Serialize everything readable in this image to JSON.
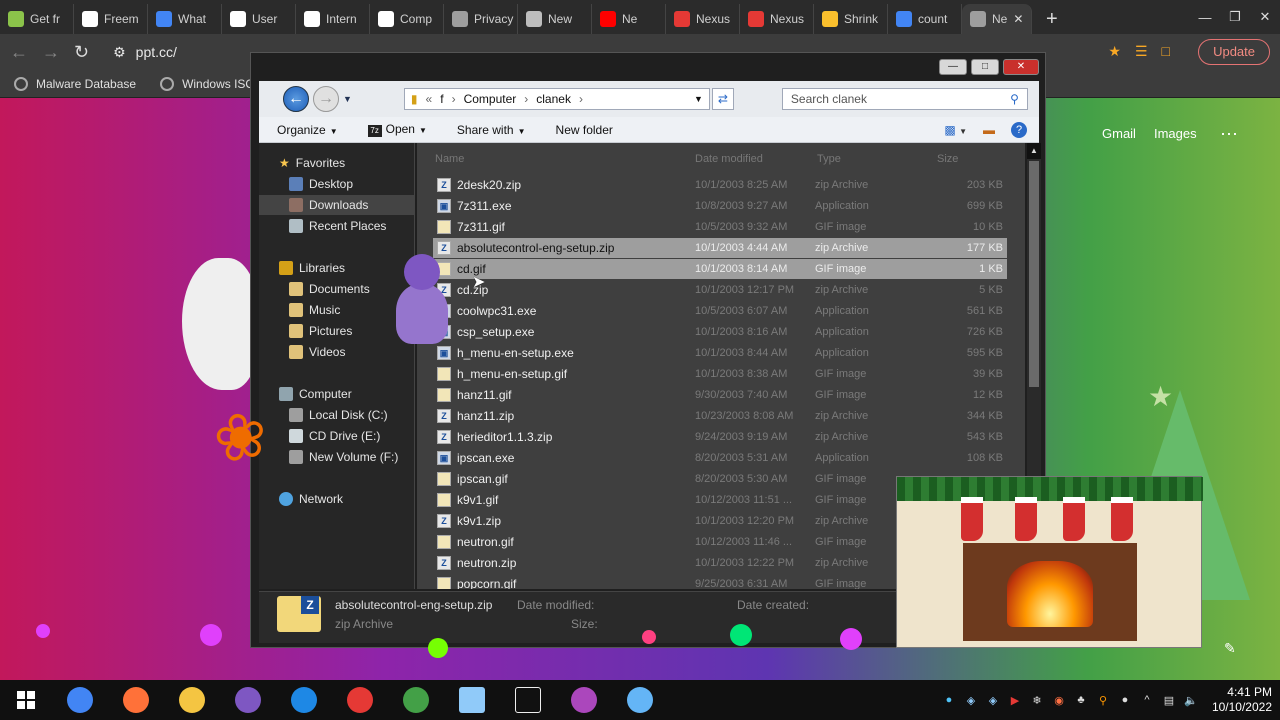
{
  "browser": {
    "tabs": [
      {
        "label": "Get fr",
        "fav_color": "#8bc34a"
      },
      {
        "label": "Freem",
        "fav_color": "#ffffff"
      },
      {
        "label": "What",
        "fav_color": "#4285f4"
      },
      {
        "label": "User",
        "fav_color": "#ffffff"
      },
      {
        "label": "Intern",
        "fav_color": "#ffffff"
      },
      {
        "label": "Comp",
        "fav_color": "#ffffff"
      },
      {
        "label": "Privacy en",
        "fav_color": "#9e9e9e"
      },
      {
        "label": "New",
        "fav_color": "#bdbdbd"
      },
      {
        "label": "Ne",
        "fav_color": "#ff0000"
      },
      {
        "label": "Nexus",
        "fav_color": "#e53935"
      },
      {
        "label": "Nexus",
        "fav_color": "#e53935"
      },
      {
        "label": "Shrink",
        "fav_color": "#fbc02d"
      },
      {
        "label": "count",
        "fav_color": "#4285f4"
      },
      {
        "label": "Ne",
        "fav_color": "#9e9e9e"
      }
    ],
    "new_tab": "+",
    "url": "ppt.cc/",
    "update_label": "Update",
    "bookmarks": [
      "Malware Database",
      "Windows ISOS"
    ]
  },
  "google": {
    "gmail": "Gmail",
    "images": "Images",
    "apps_icon": "apps-grid-icon"
  },
  "explorer": {
    "breadcrumb": {
      "lead": "«",
      "parts": [
        "f",
        "Computer",
        "clanek"
      ]
    },
    "search_placeholder": "Search clanek",
    "commands": {
      "organize": "Organize",
      "open": "Open",
      "share": "Share with",
      "new_folder": "New folder"
    },
    "nav": {
      "favorites": "Favorites",
      "desktop": "Desktop",
      "downloads": "Downloads",
      "recent": "Recent Places",
      "libraries": "Libraries",
      "documents": "Documents",
      "music": "Music",
      "pictures": "Pictures",
      "videos": "Videos",
      "computer": "Computer",
      "local_disk": "Local Disk (C:)",
      "cd_drive": "CD Drive (E:)",
      "new_volume": "New Volume (F:)",
      "network": "Network"
    },
    "columns": {
      "name": "Name",
      "date": "Date modified",
      "type": "Type",
      "size": "Size"
    },
    "files": [
      {
        "name": "2desk20.zip",
        "date": "10/1/2003 8:25 AM",
        "type": "zip Archive",
        "size": "203 KB",
        "kind": "zip"
      },
      {
        "name": "7z311.exe",
        "date": "10/8/2003 9:27 AM",
        "type": "Application",
        "size": "699 KB",
        "kind": "exe"
      },
      {
        "name": "7z311.gif",
        "date": "10/5/2003 9:32 AM",
        "type": "GIF image",
        "size": "10 KB",
        "kind": "gif"
      },
      {
        "name": "absolutecontrol-eng-setup.zip",
        "date": "10/1/2003 4:44 AM",
        "type": "zip Archive",
        "size": "177 KB",
        "kind": "zip",
        "selected": true
      },
      {
        "name": "cd.gif",
        "date": "10/1/2003 8:14 AM",
        "type": "GIF image",
        "size": "1 KB",
        "kind": "gif",
        "selected": true
      },
      {
        "name": "cd.zip",
        "date": "10/1/2003 12:17 PM",
        "type": "zip Archive",
        "size": "5 KB",
        "kind": "zip"
      },
      {
        "name": "coolwpc31.exe",
        "date": "10/5/2003 6:07 AM",
        "type": "Application",
        "size": "561 KB",
        "kind": "exe"
      },
      {
        "name": "csp_setup.exe",
        "date": "10/1/2003 8:16 AM",
        "type": "Application",
        "size": "726 KB",
        "kind": "exe"
      },
      {
        "name": "h_menu-en-setup.exe",
        "date": "10/1/2003 8:44 AM",
        "type": "Application",
        "size": "595 KB",
        "kind": "exe"
      },
      {
        "name": "h_menu-en-setup.gif",
        "date": "10/1/2003 8:38 AM",
        "type": "GIF image",
        "size": "39 KB",
        "kind": "gif"
      },
      {
        "name": "hanz11.gif",
        "date": "9/30/2003 7:40 AM",
        "type": "GIF image",
        "size": "12 KB",
        "kind": "gif"
      },
      {
        "name": "hanz11.zip",
        "date": "10/23/2003 8:08 AM",
        "type": "zip Archive",
        "size": "344 KB",
        "kind": "zip"
      },
      {
        "name": "herieditor1.1.3.zip",
        "date": "9/24/2003 9:19 AM",
        "type": "zip Archive",
        "size": "543 KB",
        "kind": "zip"
      },
      {
        "name": "ipscan.exe",
        "date": "8/20/2003 5:31 AM",
        "type": "Application",
        "size": "108 KB",
        "kind": "exe"
      },
      {
        "name": "ipscan.gif",
        "date": "8/20/2003 5:30 AM",
        "type": "GIF image",
        "size": "",
        "kind": "gif"
      },
      {
        "name": "k9v1.gif",
        "date": "10/12/2003 11:51 ...",
        "type": "GIF image",
        "size": "",
        "kind": "gif"
      },
      {
        "name": "k9v1.zip",
        "date": "10/1/2003 12:20 PM",
        "type": "zip Archive",
        "size": "",
        "kind": "zip"
      },
      {
        "name": "neutron.gif",
        "date": "10/12/2003 11:46 ...",
        "type": "GIF image",
        "size": "",
        "kind": "gif"
      },
      {
        "name": "neutron.zip",
        "date": "10/1/2003 12:22 PM",
        "type": "zip Archive",
        "size": "",
        "kind": "zip"
      },
      {
        "name": "popcorn.gif",
        "date": "9/25/2003 6:31 AM",
        "type": "GIF image",
        "size": "",
        "kind": "gif"
      }
    ],
    "details": {
      "name": "absolutecontrol-eng-setup.zip",
      "type": "zip Archive",
      "modified_label": "Date modified:",
      "created_label": "Date created:",
      "size_label": "Size:"
    }
  },
  "taskbar": {
    "apps": [
      "chrome-icon",
      "firefox-icon",
      "file-explorer-icon",
      "bonzi-icon",
      "vmware-icon",
      "yandex-icon",
      "ccleaner-icon",
      "files-icon",
      "7zip-icon",
      "chrome-canary-icon",
      "paint-icon"
    ],
    "time": "4:41 PM",
    "date": "10/10/2022"
  }
}
